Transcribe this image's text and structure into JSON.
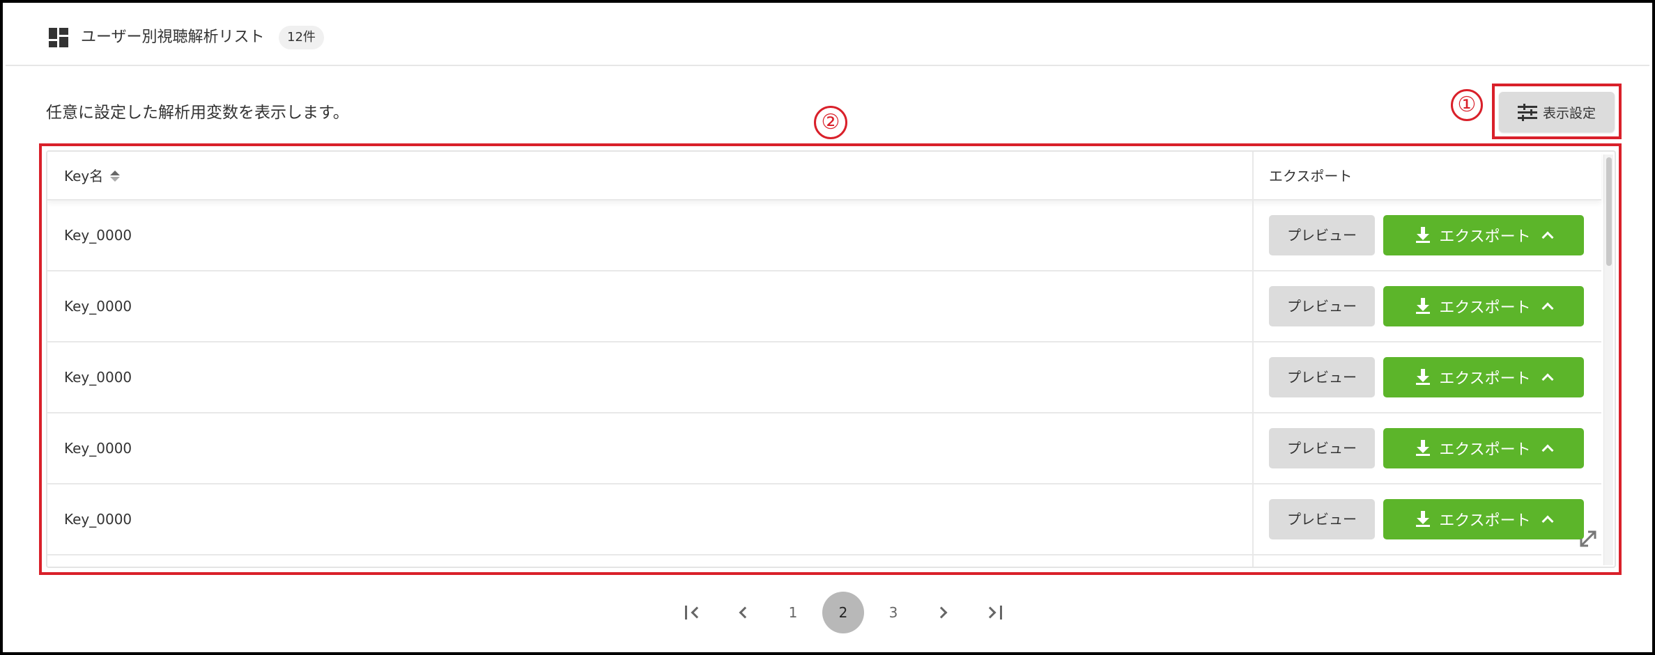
{
  "header": {
    "title": "ユーザー別視聴解析リスト",
    "count_badge": "12件"
  },
  "description": "任意に設定した解析用変数を表示します。",
  "settings_button": {
    "label": "表示設定"
  },
  "annotations": {
    "one": "①",
    "two": "②",
    "color": "#d9202a"
  },
  "table": {
    "columns": {
      "key": "Key名",
      "export": "エクスポート"
    },
    "rows": [
      {
        "key": "Key_0000",
        "preview": "プレビュー",
        "export": "エクスポート"
      },
      {
        "key": "Key_0000",
        "preview": "プレビュー",
        "export": "エクスポート"
      },
      {
        "key": "Key_0000",
        "preview": "プレビュー",
        "export": "エクスポート"
      },
      {
        "key": "Key_0000",
        "preview": "プレビュー",
        "export": "エクスポート"
      },
      {
        "key": "Key_0000",
        "preview": "プレビュー",
        "export": "エクスポート"
      }
    ]
  },
  "pagination": {
    "pages": [
      "1",
      "2",
      "3"
    ],
    "current": "2"
  },
  "colors": {
    "export_green": "#5cb52a",
    "button_gray": "#dcdcdc"
  }
}
